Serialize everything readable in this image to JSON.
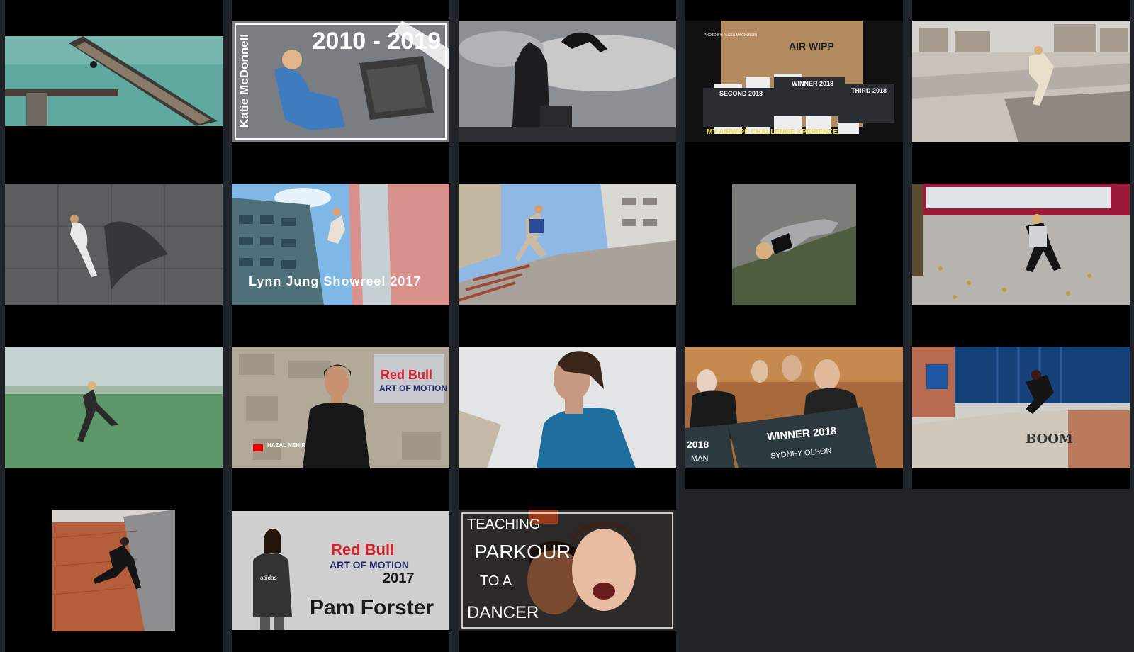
{
  "videos": [
    {
      "title": "",
      "overlay": ""
    },
    {
      "title": "Katie McDonnell 2010 - 2019",
      "overlay_year": "2010 - 2019",
      "overlay_name": "Katie McDonnell"
    },
    {
      "title": "",
      "overlay": ""
    },
    {
      "title": "My Airwipp Challenge Xperience",
      "overlay_caption": "MY AIRWIPP CHALLENGE XPERIENCE",
      "overlay_brand": "AIR WIPP",
      "overlay_credit": "PHOTO BY: ALEKS MAGNUSON",
      "cheques": [
        "SECOND 2018",
        "WINNER 2018",
        "THIRD 2018"
      ]
    },
    {
      "title": "",
      "overlay": ""
    },
    {
      "title": "",
      "overlay": ""
    },
    {
      "title": "Lynn Jung Showreel 2017",
      "overlay": "Lynn Jung Showreel 2017"
    },
    {
      "title": "",
      "overlay": ""
    },
    {
      "title": "",
      "overlay": ""
    },
    {
      "title": "",
      "overlay": ""
    },
    {
      "title": "",
      "overlay": ""
    },
    {
      "title": "Hazal Nehir Red Bull Art of Motion",
      "overlay_name": "HAZAL NEHIR",
      "overlay_brand": "Red Bull",
      "overlay_event": "ART OF MOTION"
    },
    {
      "title": "",
      "overlay": ""
    },
    {
      "title": "Winner 2018",
      "overlay": "WINNER 2018",
      "overlay_year": "2018",
      "overlay_name": "SYDNEY OLSON",
      "overlay_man": "MAN"
    },
    {
      "title": "",
      "overlay": "BOOM"
    },
    {
      "title": "",
      "overlay": ""
    },
    {
      "title": "Pam Forster Red Bull Art of Motion 2017",
      "overlay_name": "Pam Forster",
      "overlay_year": "2017",
      "overlay_brand": "Red Bull",
      "overlay_event": "ART OF MOTION",
      "overlay_shirt": "adidas"
    },
    {
      "title": "Teaching Parkour to a Dancer",
      "overlay_l1": "TEACHING",
      "overlay_l2": "PARKOUR",
      "overlay_l3": "TO A",
      "overlay_l4": "DANCER"
    }
  ],
  "colors": {
    "background": "#202428",
    "column": "#000000",
    "text": "#ffffff"
  }
}
